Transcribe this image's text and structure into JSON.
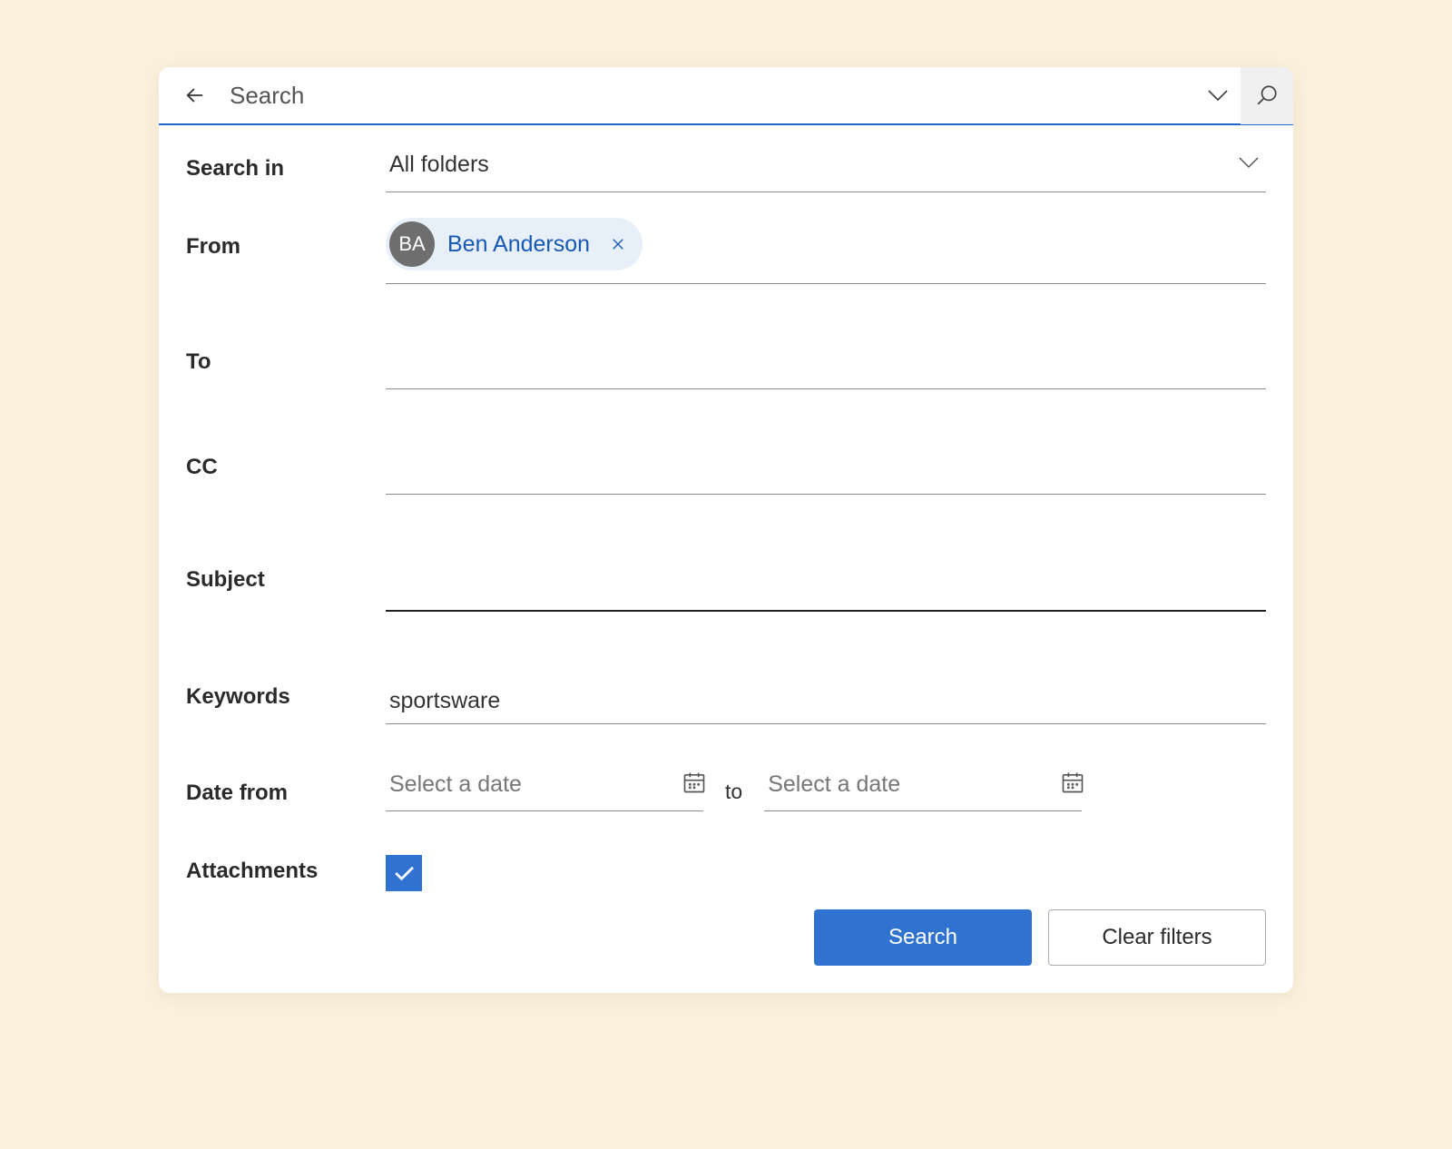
{
  "searchBar": {
    "placeholder": "Search"
  },
  "labels": {
    "searchIn": "Search in",
    "from": "From",
    "to": "To",
    "cc": "CC",
    "subject": "Subject",
    "keywords": "Keywords",
    "dateFrom": "Date from",
    "dateTo": "to",
    "attachments": "Attachments"
  },
  "values": {
    "searchIn": "All folders",
    "from": {
      "initials": "BA",
      "name": "Ben Anderson"
    },
    "to": "",
    "cc": "",
    "subject": "",
    "keywords": "sportsware",
    "dateFromPlaceholder": "Select a date",
    "dateToPlaceholder": "Select a date",
    "attachments": true
  },
  "buttons": {
    "search": "Search",
    "clear": "Clear filters"
  }
}
